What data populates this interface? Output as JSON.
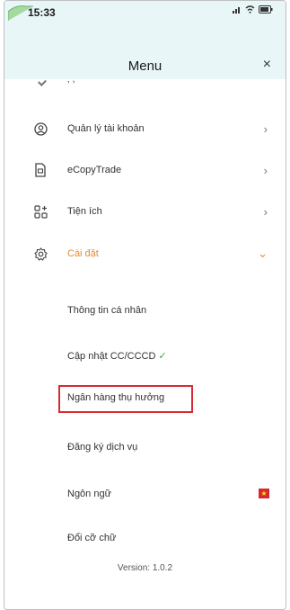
{
  "status_bar": {
    "time": "15:33"
  },
  "header": {
    "title": "Menu",
    "close_label": "×"
  },
  "menu": {
    "items": [
      {
        "label": "Quản lý tài khoản",
        "chevron": "›",
        "icon": "user-circle-icon"
      },
      {
        "label": "eCopyTrade",
        "chevron": "›",
        "icon": "document-icon"
      },
      {
        "label": "Tiện ích",
        "chevron": "›",
        "icon": "grid-plus-icon"
      },
      {
        "label": "Cài đặt",
        "chevron": "⌄",
        "icon": "settings-icon"
      }
    ],
    "settings_items": [
      {
        "label": "Thông tin cá nhân"
      },
      {
        "label": "Cập nhật CC/CCCD",
        "badge": "✓"
      },
      {
        "label": "Ngân hàng thụ hưởng"
      },
      {
        "label": "Đăng ký dịch vụ"
      },
      {
        "label": "Ngôn ngữ",
        "flag": "vietnam-flag-icon"
      },
      {
        "label": "Đổi cỡ chữ"
      }
    ]
  },
  "footer": {
    "version": "Version: 1.0.2"
  },
  "colors": {
    "accent": "#e68a2e",
    "highlight": "#d62b35",
    "header_bg": "#e8f6f8",
    "check": "#37a84a"
  }
}
